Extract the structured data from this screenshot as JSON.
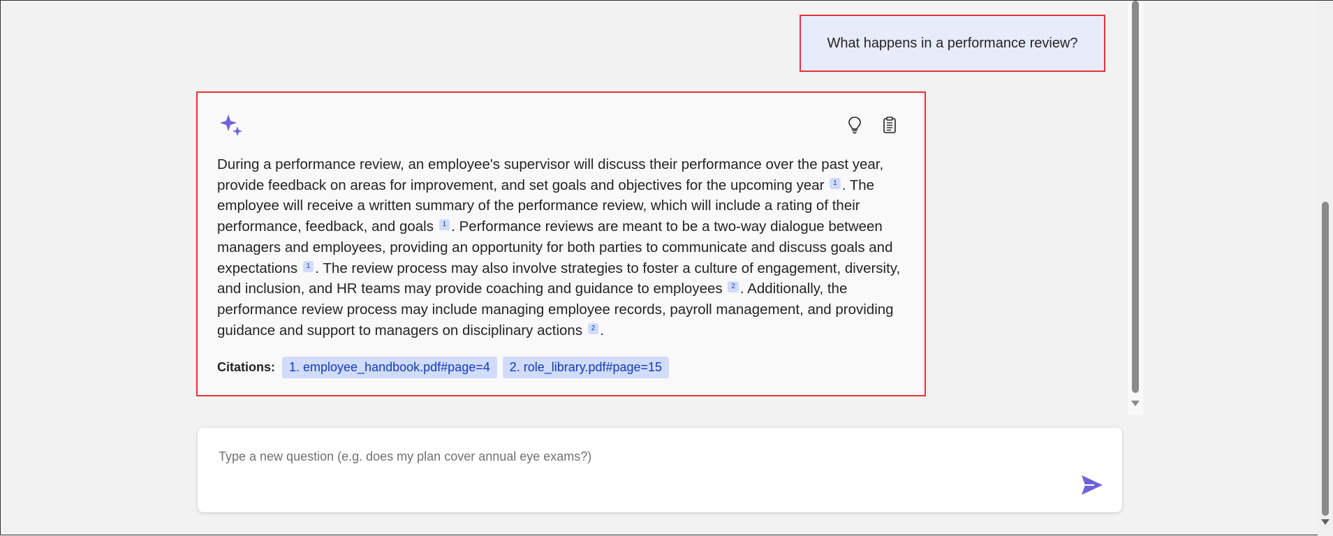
{
  "user_message": "What happens in a performance review?",
  "answer": {
    "segments": [
      "During a performance review, an employee's supervisor will discuss their performance over the past year, provide feedback on areas for improvement, and set goals and objectives for the upcoming year ",
      ". The employee will receive a written summary of the performance review, which will include a rating of their performance, feedback, and goals ",
      ". Performance reviews are meant to be a two-way dialogue between managers and employees, providing an opportunity for both parties to communicate and discuss goals and expectations ",
      ". The review process may also involve strategies to foster a culture of engagement, diversity, and inclusion, and HR teams may provide coaching and guidance to employees ",
      ". Additionally, the performance review process may include managing employee records, payroll management, and providing guidance and support to managers on disciplinary actions ",
      "."
    ],
    "refs": [
      "1",
      "1",
      "1",
      "2",
      "2"
    ],
    "icons": [
      "sparkle-icon",
      "lightbulb-icon",
      "clipboard-icon"
    ],
    "citations_label": "Citations:",
    "citations": [
      "1. employee_handbook.pdf#page=4",
      "2. role_library.pdf#page=15"
    ]
  },
  "input": {
    "placeholder": "Type a new question (e.g. does my plan cover annual eye exams?)",
    "value": ""
  },
  "colors": {
    "accent": "#6c63d9",
    "highlight_border": "#e5313a",
    "user_bubble_bg": "#e8ebfa",
    "citation_bg": "#d1dbfa",
    "citation_text": "#123bb6"
  }
}
